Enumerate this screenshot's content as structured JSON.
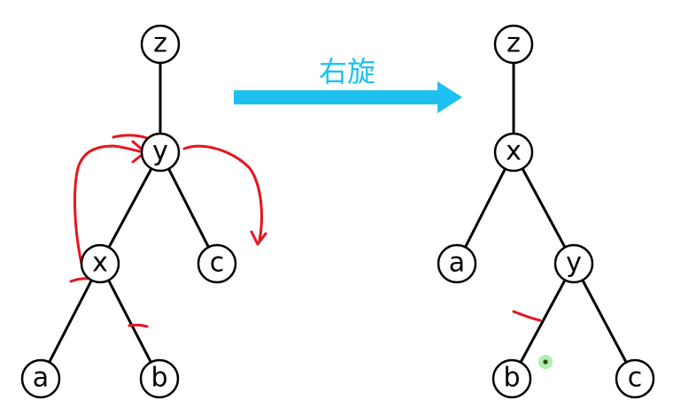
{
  "rotation": {
    "label": "右旋",
    "color": "#1ec0ef"
  },
  "left_tree": {
    "nodes": [
      {
        "id": "z",
        "label": "z"
      },
      {
        "id": "y",
        "label": "y"
      },
      {
        "id": "x",
        "label": "x"
      },
      {
        "id": "c",
        "label": "c"
      },
      {
        "id": "a",
        "label": "a"
      },
      {
        "id": "b",
        "label": "b"
      }
    ],
    "edges": [
      [
        "z",
        "y"
      ],
      [
        "y",
        "x"
      ],
      [
        "y",
        "c"
      ],
      [
        "x",
        "a"
      ],
      [
        "x",
        "b"
      ]
    ]
  },
  "right_tree": {
    "nodes": [
      {
        "id": "z",
        "label": "z"
      },
      {
        "id": "x",
        "label": "x"
      },
      {
        "id": "a",
        "label": "a"
      },
      {
        "id": "y",
        "label": "y"
      },
      {
        "id": "b",
        "label": "b"
      },
      {
        "id": "c",
        "label": "c"
      }
    ],
    "edges": [
      [
        "z",
        "x"
      ],
      [
        "x",
        "a"
      ],
      [
        "x",
        "y"
      ],
      [
        "y",
        "b"
      ],
      [
        "y",
        "c"
      ]
    ]
  },
  "annotation_color": "#e8141e",
  "cursor_color": "#6ee06a"
}
